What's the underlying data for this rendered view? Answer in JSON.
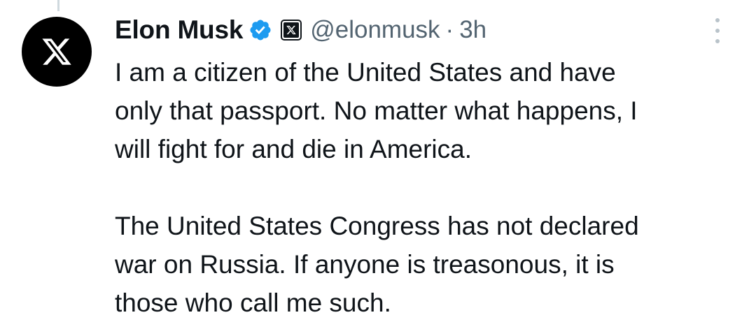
{
  "tweet": {
    "author": {
      "display_name": "Elon Musk",
      "handle": "@elonmusk",
      "avatar_icon": "x-logo-icon",
      "verified_icon": "verified-badge-icon",
      "affiliate_icon": "x-affiliate-badge-icon"
    },
    "separator": "·",
    "time": "3h",
    "more_icon": "more-vertical-icon",
    "paragraphs": [
      {
        "lines": [
          "I am a citizen of the United States and have",
          "only that passport. No matter what happens, I",
          "will fight for and die in America."
        ]
      },
      {
        "lines": [
          "The United States Congress has not declared",
          "war on Russia. If anyone is treasonous, it is",
          "those who call me such."
        ]
      }
    ]
  },
  "colors": {
    "text_primary": "#0f1419",
    "text_secondary": "#536471",
    "verified_blue": "#1d9bf0",
    "avatar_bg": "#000000"
  }
}
